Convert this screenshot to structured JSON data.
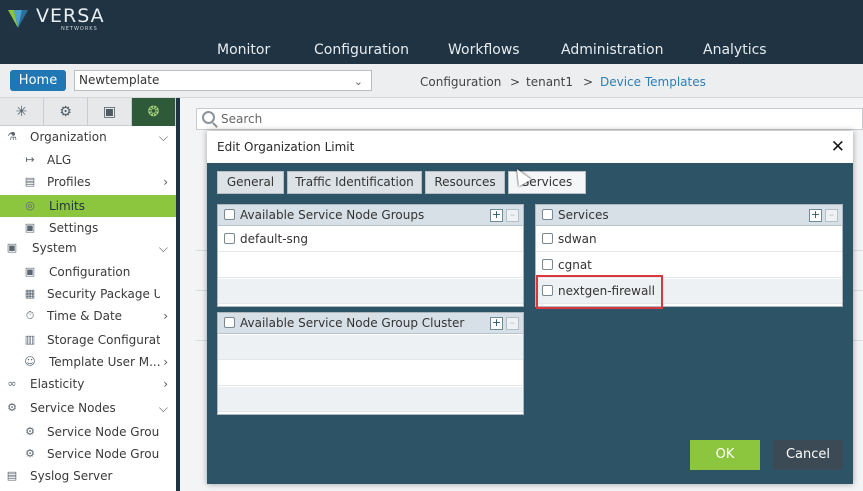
{
  "brand": {
    "name": "VERSA",
    "sub": "NETWORKS",
    "accent": "#8cc63f",
    "dark": "#1f3342"
  },
  "nav": {
    "items": [
      "Monitor",
      "Configuration",
      "Workflows",
      "Administration",
      "Analytics"
    ]
  },
  "crumbbar": {
    "home": "Home",
    "template": "Newtemplate",
    "crumbs": [
      "Configuration",
      ">",
      "tenant1",
      ">",
      "Device Templates"
    ]
  },
  "sidebar": {
    "tab_icons": [
      "network-icon",
      "gear-icon",
      "cube-icon",
      "globe-gear-icon"
    ],
    "items": [
      {
        "label": "Organization",
        "icon": "org-icon",
        "arrow": "⌵"
      },
      {
        "label": "ALG",
        "icon": "alg-icon",
        "arrow": ""
      },
      {
        "label": "Profiles",
        "icon": "profiles-icon",
        "arrow": "›"
      },
      {
        "label": "Limits",
        "icon": "limits-icon",
        "arrow": "",
        "active": true
      },
      {
        "label": "Settings",
        "icon": "settings-icon",
        "arrow": ""
      },
      {
        "label": "System",
        "icon": "system-icon",
        "arrow": "⌵"
      },
      {
        "label": "Configuration",
        "icon": "config-icon",
        "arrow": ""
      },
      {
        "label": "Security Package Up...",
        "icon": "security-icon",
        "arrow": ""
      },
      {
        "label": "Time & Date",
        "icon": "clock-icon",
        "arrow": "›"
      },
      {
        "label": "Storage Configurations",
        "icon": "storage-icon",
        "arrow": ""
      },
      {
        "label": "Template User M...",
        "icon": "users-icon",
        "arrow": "›"
      },
      {
        "label": "Elasticity",
        "icon": "elasticity-icon",
        "arrow": "›"
      },
      {
        "label": "Service Nodes",
        "icon": "service-nodes-icon",
        "arrow": "⌵"
      },
      {
        "label": "Service Node Groups",
        "icon": "service-node-groups-icon",
        "arrow": ""
      },
      {
        "label": "Service Node Group ...",
        "icon": "service-node-group-icon",
        "arrow": ""
      },
      {
        "label": "Syslog Server",
        "icon": "syslog-icon",
        "arrow": ""
      }
    ]
  },
  "search": {
    "placeholder": "Search"
  },
  "modal": {
    "title": "Edit Organization Limit",
    "close": "✕",
    "tabs": [
      "General",
      "Traffic Identification",
      "Resources",
      "Services"
    ],
    "active_tab": "Services",
    "sng_panel": {
      "title": "Available Service Node Groups",
      "rows": [
        "default-sng"
      ]
    },
    "cluster_panel": {
      "title": "Available Service Node Group Cluster",
      "rows": []
    },
    "services_panel": {
      "title": "Services",
      "rows": [
        "sdwan",
        "cgnat",
        "nextgen-firewall"
      ],
      "highlighted": "nextgen-firewall"
    },
    "ok": "OK",
    "cancel": "Cancel"
  }
}
